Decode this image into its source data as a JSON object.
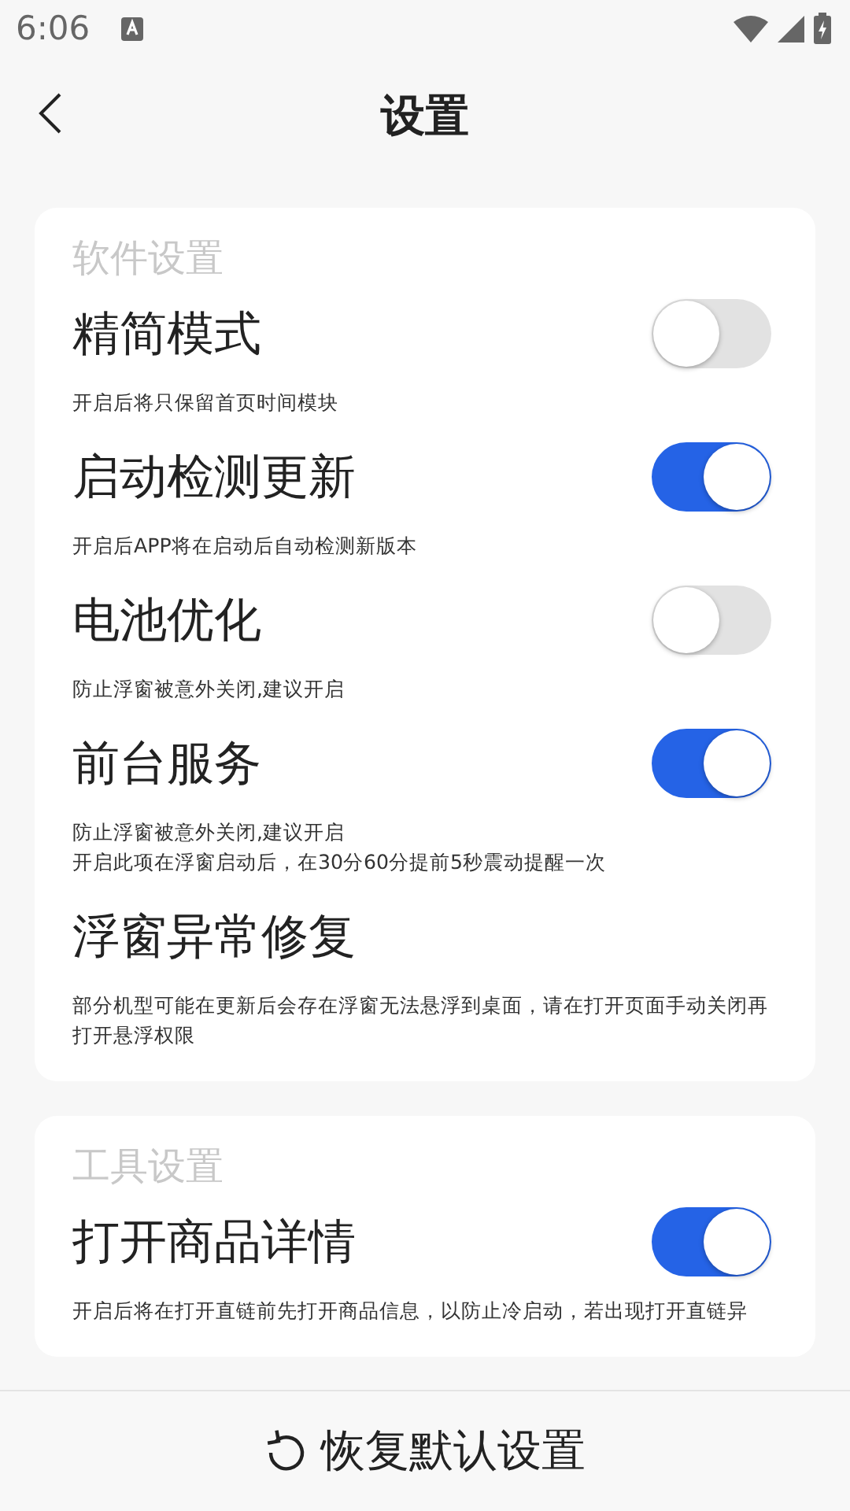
{
  "status_bar": {
    "time": "6:06"
  },
  "header": {
    "title": "设置"
  },
  "sections": [
    {
      "title": "软件设置",
      "items": [
        {
          "kind": "toggle",
          "label": "精简模式",
          "on": false,
          "description": [
            "开启后将只保留首页时间模块"
          ]
        },
        {
          "kind": "toggle",
          "label": "启动检测更新",
          "on": true,
          "description": [
            "开启后APP将在启动后自动检测新版本"
          ]
        },
        {
          "kind": "toggle",
          "label": "电池优化",
          "on": false,
          "description": [
            "防止浮窗被意外关闭,建议开启"
          ]
        },
        {
          "kind": "toggle",
          "label": "前台服务",
          "on": true,
          "description": [
            "防止浮窗被意外关闭,建议开启",
            "开启此项在浮窗启动后，在30分60分提前5秒震动提醒一次"
          ]
        },
        {
          "kind": "action",
          "label": "浮窗异常修复",
          "description": [
            "部分机型可能在更新后会存在浮窗无法悬浮到桌面，请在打开页面手动关闭再打开悬浮权限"
          ]
        }
      ]
    },
    {
      "title": "工具设置",
      "items": [
        {
          "kind": "toggle",
          "label": "打开商品详情",
          "on": true,
          "description": [
            "开启后将在打开直链前先打开商品信息，以防止冷启动，若出现打开直链异"
          ]
        }
      ]
    }
  ],
  "bottom_button": {
    "label": "恢复默认设置"
  }
}
